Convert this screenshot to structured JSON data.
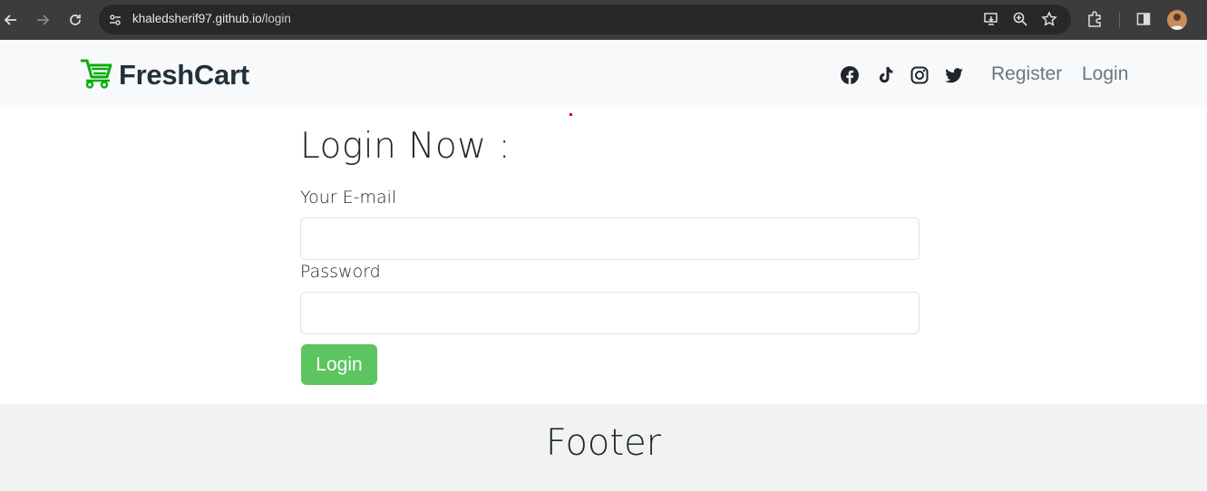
{
  "browser": {
    "url_host": "khaledsherif97.github.io",
    "url_path": "/login"
  },
  "navbar": {
    "brand": "FreshCart",
    "brand_color": "#0aad0a",
    "links": [
      {
        "label": "Register"
      },
      {
        "label": "Login"
      }
    ],
    "social_icons": [
      "facebook-icon",
      "tiktok-icon",
      "instagram-icon",
      "twitter-icon"
    ]
  },
  "login": {
    "title": "Login Now :",
    "email_label": "Your E-mail",
    "email_value": "",
    "password_label": "Password",
    "password_value": "",
    "submit_label": "Login",
    "submit_color": "#5cc55f"
  },
  "footer": {
    "title": "Footer"
  }
}
